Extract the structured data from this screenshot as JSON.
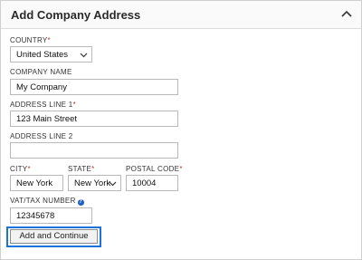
{
  "header": {
    "title": "Add Company Address",
    "collapse_icon": "chevron-up-icon"
  },
  "form": {
    "country": {
      "label": "COUNTRY",
      "required": true,
      "value": "United States"
    },
    "company_name": {
      "label": "COMPANY NAME",
      "required": false,
      "value": "My Company"
    },
    "address_line_1": {
      "label": "ADDRESS LINE 1",
      "required": true,
      "value": "123 Main Street"
    },
    "address_line_2": {
      "label": "ADDRESS LINE 2",
      "required": false,
      "value": ""
    },
    "city": {
      "label": "CITY",
      "required": true,
      "value": "New York"
    },
    "state": {
      "label": "STATE",
      "required": true,
      "value": "New York"
    },
    "postal_code": {
      "label": "POSTAL CODE",
      "required": true,
      "value": "10004"
    },
    "vat": {
      "label": "VAT/TAX NUMBER",
      "help_icon": "question-circle-icon",
      "help_glyph": "?",
      "value": "12345678"
    },
    "required_marker": "*"
  },
  "actions": {
    "submit_label": "Add and Continue"
  },
  "colors": {
    "required": "#c0392b",
    "focus": "#1a73d9",
    "help": "#1e5fbf"
  }
}
